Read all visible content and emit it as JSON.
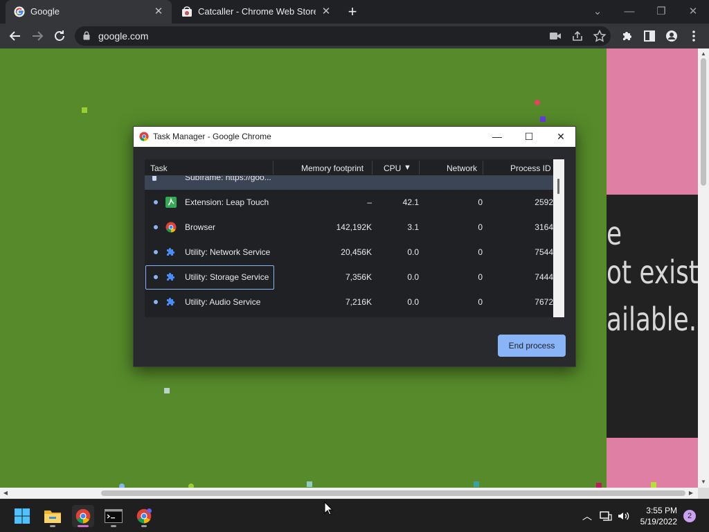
{
  "browser": {
    "tabs": [
      {
        "title": "Google",
        "icon": "google-g-icon",
        "active": true
      },
      {
        "title": "Catcaller - Chrome Web Store",
        "icon": "web-store-icon",
        "active": false
      }
    ],
    "close_glyph": "✕",
    "new_tab_glyph": "+",
    "window_controls": {
      "dropdown": "⌄",
      "minimize": "—",
      "restore": "❐",
      "close": "✕"
    },
    "address": {
      "url": "google.com"
    }
  },
  "page": {
    "fragment_lines": [
      "e",
      "ot exist",
      "ailable."
    ],
    "colors": {
      "background": "#568a2a",
      "pink": "#de7fa3",
      "dark": "#222222"
    }
  },
  "task_manager": {
    "title": "Task Manager - Google Chrome",
    "window_controls": {
      "minimize": "—",
      "maximize": "☐",
      "close": "✕"
    },
    "columns": {
      "task": "Task",
      "memory": "Memory footprint",
      "cpu": "CPU",
      "cpu_sort": "▼",
      "network": "Network",
      "pid": "Process ID"
    },
    "rows": [
      {
        "name": "Subframe: https://goo...",
        "memory": "",
        "cpu": "",
        "network": "",
        "pid": "",
        "icon": "subframe-icon",
        "selected": true
      },
      {
        "name": "Extension: Leap Touch",
        "memory": "–",
        "cpu": "42.1",
        "network": "0",
        "pid": "2592",
        "icon": "extension-leap-icon"
      },
      {
        "name": "Browser",
        "memory": "142,192K",
        "cpu": "3.1",
        "network": "0",
        "pid": "3164",
        "icon": "chrome-icon"
      },
      {
        "name": "Utility: Network Service",
        "memory": "20,456K",
        "cpu": "0.0",
        "network": "0",
        "pid": "7544",
        "icon": "puzzle-icon"
      },
      {
        "name": "Utility: Storage Service",
        "memory": "7,356K",
        "cpu": "0.0",
        "network": "0",
        "pid": "7444",
        "icon": "puzzle-icon",
        "focused": true
      },
      {
        "name": "Utility: Audio Service",
        "memory": "7,216K",
        "cpu": "0.0",
        "network": "0",
        "pid": "7672",
        "icon": "puzzle-icon"
      }
    ],
    "end_process_label": "End process"
  },
  "taskbar": {
    "apps": [
      "windows-start-icon",
      "file-explorer-icon",
      "chrome-icon",
      "terminal-icon",
      "chrome-profile-icon"
    ],
    "time": "3:55 PM",
    "date": "5/19/2022",
    "notification_count": "2",
    "tray": {
      "chevron": "︿",
      "speaker": "🔊"
    }
  }
}
